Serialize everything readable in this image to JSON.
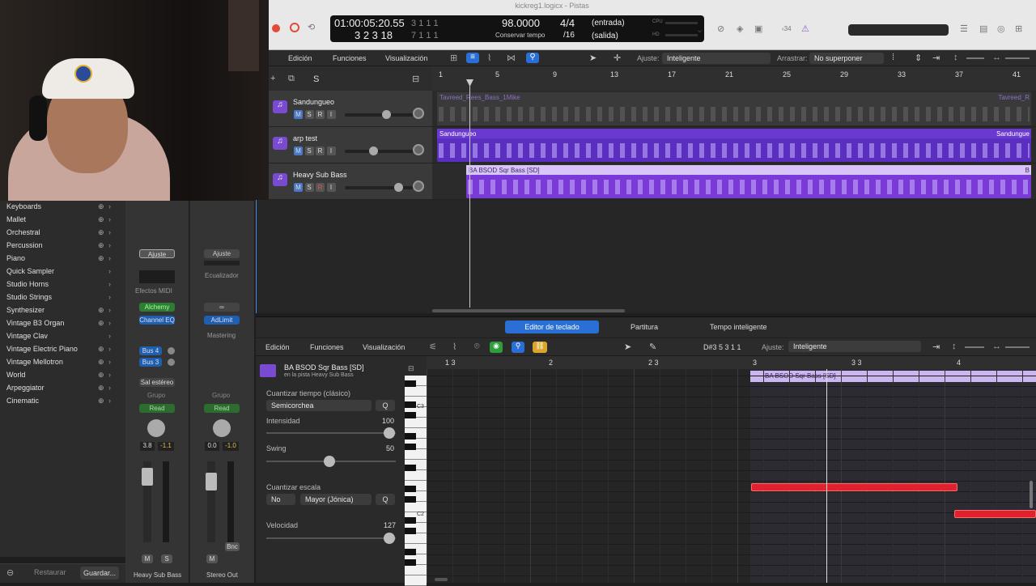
{
  "window": {
    "title": "kickreg1.logicx - Pistas"
  },
  "lcd": {
    "time": "01:00:05:20.55",
    "bars_top": "3  1  1  1",
    "bars_bottom": "3  2  3  18",
    "bars_bottom2": "7  1  1  1",
    "tempo": "98.0000",
    "tempo_sub": "Conservar tempo",
    "sig": "4/4",
    "div": "/16",
    "in": "(entrada)",
    "out": "(salida)",
    "cpu": "CPU",
    "hd": "HD"
  },
  "toolbar_ext": {
    "tracks_count": "‹34"
  },
  "arrange_toolbar": {
    "edit": "Edición",
    "functions": "Funciones",
    "view": "Visualización",
    "snap_label": "Ajuste:",
    "snap_value": "Inteligente",
    "drag_label": "Arrastrar:",
    "drag_value": "No superponer"
  },
  "arrange_ruler": [
    "1",
    "5",
    "9",
    "13",
    "17",
    "21",
    "25",
    "29",
    "33",
    "37",
    "41"
  ],
  "tracks": [
    {
      "name": "Sandungueo",
      "m": "M",
      "s": "S",
      "r": "R",
      "i": "I",
      "region": "Tavreed_Rees_Bass_1Mike",
      "region_end": "Tavreed_R"
    },
    {
      "name": "arp test",
      "m": "M",
      "s": "S",
      "r": "R",
      "i": "I",
      "region": "Sandungueo",
      "region_end": "Sandungue"
    },
    {
      "name": "Heavy Sub Bass",
      "m": "M",
      "s": "S",
      "r": "R",
      "i": "I",
      "region": "BA BSOD Sqr Bass [SD]",
      "region_end": "B"
    }
  ],
  "library": [
    {
      "label": "Keyboards",
      "plus": true
    },
    {
      "label": "Mallet",
      "plus": true
    },
    {
      "label": "Orchestral",
      "plus": true
    },
    {
      "label": "Percussion",
      "plus": true
    },
    {
      "label": "Piano",
      "plus": true
    },
    {
      "label": "Quick Sampler",
      "plus": false
    },
    {
      "label": "Studio Horns",
      "plus": false
    },
    {
      "label": "Studio Strings",
      "plus": false
    },
    {
      "label": "Synthesizer",
      "plus": true
    },
    {
      "label": "Vintage B3 Organ",
      "plus": true
    },
    {
      "label": "Vintage Clav",
      "plus": false
    },
    {
      "label": "Vintage Electric Piano",
      "plus": true
    },
    {
      "label": "Vintage Mellotron",
      "plus": true
    },
    {
      "label": "World",
      "plus": true
    },
    {
      "label": "Arpeggiator",
      "plus": true
    },
    {
      "label": "Cinematic",
      "plus": true
    }
  ],
  "library_footer": {
    "restore": "Restaurar",
    "save": "Guardar..."
  },
  "mixer": {
    "strip1": {
      "settings": "Ajuste",
      "midi_fx": "Efectos MIDI",
      "instrument": "Alchemy",
      "eq": "Channel EQ",
      "bus4": "Bus 4",
      "bus3": "Bus 3",
      "output": "Sal estéreo",
      "group": "Grupo",
      "auto": "Read",
      "vol": "3.8",
      "peak": "-1.1",
      "m": "M",
      "s": "S",
      "name": "Heavy Sub Bass"
    },
    "strip2": {
      "settings": "Ajuste",
      "eq": "Ecualizador",
      "link": "∞",
      "limit": "AdLimit",
      "mastering": "Mastering",
      "group": "Grupo",
      "auto": "Read",
      "vol": "0.0",
      "peak": "-1.0",
      "m": "M",
      "bnc": "Bnc",
      "name": "Stereo Out"
    }
  },
  "editor_tabs": {
    "piano": "Editor de teclado",
    "score": "Partitura",
    "smart_tempo": "Tempo inteligente"
  },
  "editor_toolbar": {
    "edit": "Edición",
    "functions": "Funciones",
    "view": "Visualización",
    "position": "D#3  5 3 1 1",
    "snap_label": "Ajuste:",
    "snap_value": "Inteligente"
  },
  "region_info": {
    "name": "BA BSOD Sqr Bass [SD]",
    "track": "en la pista Heavy Sub Bass"
  },
  "inspector": {
    "quantize_label": "Cuantizar tiempo (clásico)",
    "quantize_value": "Semicorchea",
    "q": "Q",
    "strength_label": "Intensidad",
    "strength_value": "100",
    "swing_label": "Swing",
    "swing_value": "50",
    "scale_label": "Cuantizar escala",
    "scale_no": "No",
    "scale_value": "Mayor (Jónica)",
    "q2": "Q",
    "velocity_label": "Velocidad",
    "velocity_value": "127"
  },
  "editor_ruler": [
    "1 3",
    "2",
    "2 3",
    "3",
    "3 3",
    "4"
  ],
  "editor_region": "BA BSOD Sqr Bass [SD]",
  "keys": {
    "c3": "C3",
    "c2": "C2"
  }
}
